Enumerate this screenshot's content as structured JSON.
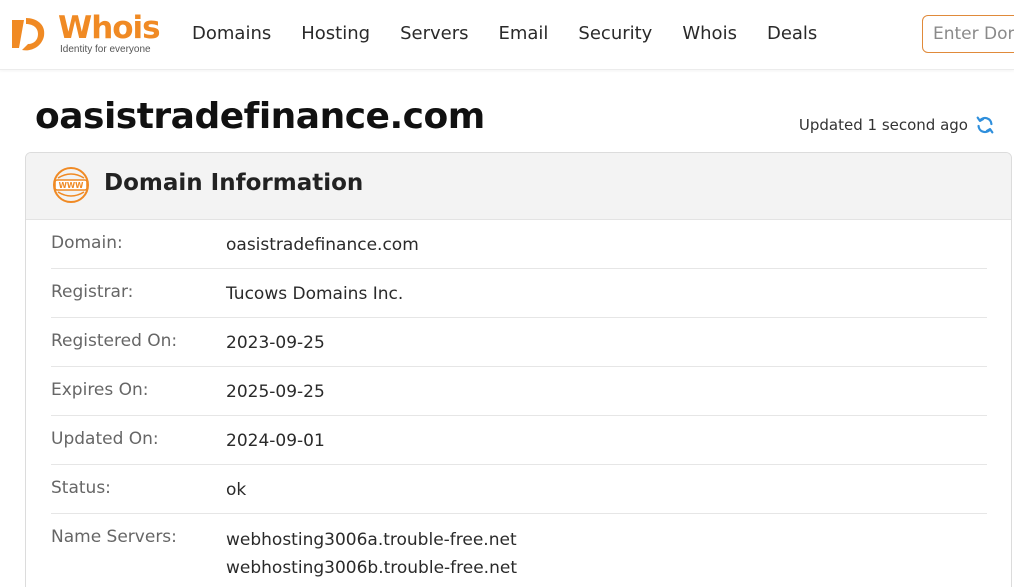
{
  "brand": {
    "name": "Whois",
    "tagline": "Identity for everyone",
    "color": "#f08a24"
  },
  "nav": {
    "items": [
      "Domains",
      "Hosting",
      "Servers",
      "Email",
      "Security",
      "Whois",
      "Deals"
    ]
  },
  "search": {
    "placeholder": "Enter Domain or IP"
  },
  "page": {
    "title": "oasistradefinance.com",
    "updated": "Updated 1 second ago"
  },
  "domain_info": {
    "title": "Domain Information",
    "rows": [
      {
        "label": "Domain:",
        "value": "oasistradefinance.com"
      },
      {
        "label": "Registrar:",
        "value": "Tucows Domains Inc."
      },
      {
        "label": "Registered On:",
        "value": "2023-09-25"
      },
      {
        "label": "Expires On:",
        "value": "2025-09-25"
      },
      {
        "label": "Updated On:",
        "value": "2024-09-01"
      },
      {
        "label": "Status:",
        "value": "ok"
      }
    ],
    "name_servers": {
      "label": "Name Servers:",
      "values": [
        "webhosting3006a.trouble-free.net",
        "webhosting3006b.trouble-free.net"
      ]
    }
  },
  "icons": {
    "logo": "whois-logo-icon",
    "refresh": "refresh-icon",
    "www": "www-globe-icon"
  },
  "colors": {
    "accent": "#f08a24",
    "refresh": "#2f8fdc",
    "search_border": "#e08a3a"
  }
}
